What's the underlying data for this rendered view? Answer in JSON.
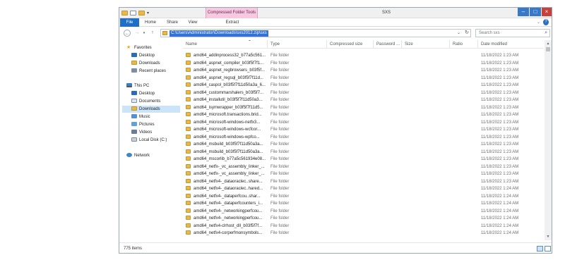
{
  "window": {
    "title": "SXS",
    "context_tab": "Compressed Folder Tools"
  },
  "ribbon": {
    "tabs": [
      "File",
      "Home",
      "Share",
      "View",
      "Extract"
    ]
  },
  "address": {
    "path": "C:\\Users\\Administrator\\Downloads\\sxs2012.zip\\sxs",
    "search_placeholder": "Search sxs"
  },
  "nav": {
    "favorites_label": "Favorites",
    "favorites": [
      "Desktop",
      "Downloads",
      "Recent places"
    ],
    "thispc_label": "This PC",
    "thispc": [
      "Desktop",
      "Documents",
      "Downloads",
      "Music",
      "Pictures",
      "Videos",
      "Local Disk (C:)"
    ],
    "network_label": "Network",
    "selected": "Downloads"
  },
  "columns": [
    "Name",
    "Type",
    "Compressed size",
    "Password ...",
    "Size",
    "Ratio",
    "Date modified"
  ],
  "files": [
    {
      "name": "amd64_addinprocess32_b77a5c561...",
      "type": "File folder",
      "date": "11/18/2022 1:23 AM"
    },
    {
      "name": "amd64_aspnet_compiler_b03f5f7f1...",
      "type": "File folder",
      "date": "11/18/2022 1:23 AM"
    },
    {
      "name": "amd64_aspnet_regbrowsers_b03f5f...",
      "type": "File folder",
      "date": "11/18/2022 1:23 AM"
    },
    {
      "name": "amd64_aspnet_regsql_b03f5f7f11d...",
      "type": "File folder",
      "date": "11/18/2022 1:23 AM"
    },
    {
      "name": "amd64_caspol_b03f5f7f11d50a3a_6...",
      "type": "File folder",
      "date": "11/18/2022 1:23 AM"
    },
    {
      "name": "amd64_custommarshalers_b03f5f7...",
      "type": "File folder",
      "date": "11/18/2022 1:23 AM"
    },
    {
      "name": "amd64_installutil_b03f5f7f11d50a3...",
      "type": "File folder",
      "date": "11/18/2022 1:23 AM"
    },
    {
      "name": "amd64_isymwrapper_b03f5f7f11d5...",
      "type": "File folder",
      "date": "11/18/2022 1:23 AM"
    },
    {
      "name": "amd64_microsoft.transactions.brid...",
      "type": "File folder",
      "date": "11/18/2022 1:23 AM"
    },
    {
      "name": "amd64_microsoft-windows-netfx3...",
      "type": "File folder",
      "date": "11/18/2022 1:23 AM"
    },
    {
      "name": "amd64_microsoft-windows-wcfcor...",
      "type": "File folder",
      "date": "11/18/2022 1:23 AM"
    },
    {
      "name": "amd64_microsoft-windows-wpfco...",
      "type": "File folder",
      "date": "11/18/2022 1:23 AM"
    },
    {
      "name": "amd64_msbuild_b03f5f7f11d50a3a...",
      "type": "File folder",
      "date": "11/18/2022 1:23 AM"
    },
    {
      "name": "amd64_msbuild_b03f5f7f11d50a3a...",
      "type": "File folder",
      "date": "11/18/2022 1:23 AM"
    },
    {
      "name": "amd64_mscorlib_b77a5c561934e08...",
      "type": "File folder",
      "date": "11/18/2022 1:23 AM"
    },
    {
      "name": "amd64_netfx-_vc_assembly_linker_...",
      "type": "File folder",
      "date": "11/18/2022 1:23 AM"
    },
    {
      "name": "amd64_netfx-_vc_assembly_linker_...",
      "type": "File folder",
      "date": "11/18/2022 1:23 AM"
    },
    {
      "name": "amd64_netfx4-_dataoraclec..share...",
      "type": "File folder",
      "date": "11/18/2022 1:23 AM"
    },
    {
      "name": "amd64_netfx4-_dataoraclec..hared...",
      "type": "File folder",
      "date": "11/18/2022 1:24 AM"
    },
    {
      "name": "amd64_netfx4-_dataperfcou..shar...",
      "type": "File folder",
      "date": "11/18/2022 1:24 AM"
    },
    {
      "name": "amd64_netfx4-_dataperfcounters_i...",
      "type": "File folder",
      "date": "11/18/2022 1:24 AM"
    },
    {
      "name": "amd64_netfx4-_networkingperfcou...",
      "type": "File folder",
      "date": "11/18/2022 1:24 AM"
    },
    {
      "name": "amd64_netfx4-_networkingperfcou...",
      "type": "File folder",
      "date": "11/18/2022 1:24 AM"
    },
    {
      "name": "amd64_netfx4-clrhost_dll_b03f5f7f...",
      "type": "File folder",
      "date": "11/18/2022 1:24 AM"
    },
    {
      "name": "amd64_netfx4-corperfmonsymbols...",
      "type": "File folder",
      "date": "11/18/2022 1:24 AM"
    }
  ],
  "status": {
    "item_count": "775 items"
  },
  "colors": {
    "accent": "#1f6fc5",
    "context_tab": "#f6c9e0",
    "selection": "#cce4f7",
    "folder": "#e8b94a"
  }
}
